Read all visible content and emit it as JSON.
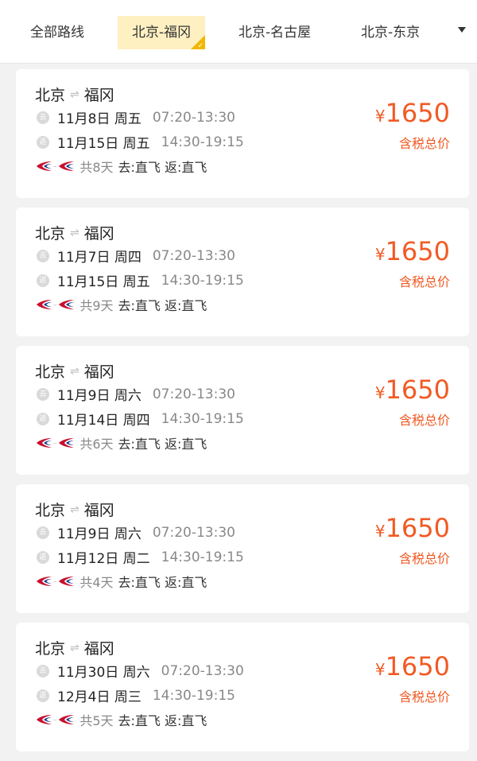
{
  "tabs": [
    {
      "label": "全部路线",
      "active": false
    },
    {
      "label": "北京-福冈",
      "active": true
    },
    {
      "label": "北京-名古屋",
      "active": false
    },
    {
      "label": "北京-东京",
      "active": false
    }
  ],
  "icons": {
    "swap": "⇌",
    "depart_tag": "去",
    "return_tag": "返",
    "active_check": "✓"
  },
  "colors": {
    "price": "#f15a24",
    "active_tab_bg": "#fff0c2",
    "active_tab_corner": "#f2b705"
  },
  "trips": [
    {
      "from": "北京",
      "to": "福冈",
      "depart_date": "11月8日 周五",
      "depart_time": "07:20-13:30",
      "return_date": "11月15日 周五",
      "return_time": "14:30-19:15",
      "days": "共8天",
      "flight": "去:直飞 返:直飞",
      "currency": "¥",
      "price": "1650",
      "price_note": "含税总价"
    },
    {
      "from": "北京",
      "to": "福冈",
      "depart_date": "11月7日 周四",
      "depart_time": "07:20-13:30",
      "return_date": "11月15日 周五",
      "return_time": "14:30-19:15",
      "days": "共9天",
      "flight": "去:直飞 返:直飞",
      "currency": "¥",
      "price": "1650",
      "price_note": "含税总价"
    },
    {
      "from": "北京",
      "to": "福冈",
      "depart_date": "11月9日 周六",
      "depart_time": "07:20-13:30",
      "return_date": "11月14日 周四",
      "return_time": "14:30-19:15",
      "days": "共6天",
      "flight": "去:直飞 返:直飞",
      "currency": "¥",
      "price": "1650",
      "price_note": "含税总价"
    },
    {
      "from": "北京",
      "to": "福冈",
      "depart_date": "11月9日 周六",
      "depart_time": "07:20-13:30",
      "return_date": "11月12日 周二",
      "return_time": "14:30-19:15",
      "days": "共4天",
      "flight": "去:直飞 返:直飞",
      "currency": "¥",
      "price": "1650",
      "price_note": "含税总价"
    },
    {
      "from": "北京",
      "to": "福冈",
      "depart_date": "11月30日 周六",
      "depart_time": "07:20-13:30",
      "return_date": "12月4日 周三",
      "return_time": "14:30-19:15",
      "days": "共5天",
      "flight": "去:直飞 返:直飞",
      "currency": "¥",
      "price": "1650",
      "price_note": "含税总价"
    }
  ]
}
